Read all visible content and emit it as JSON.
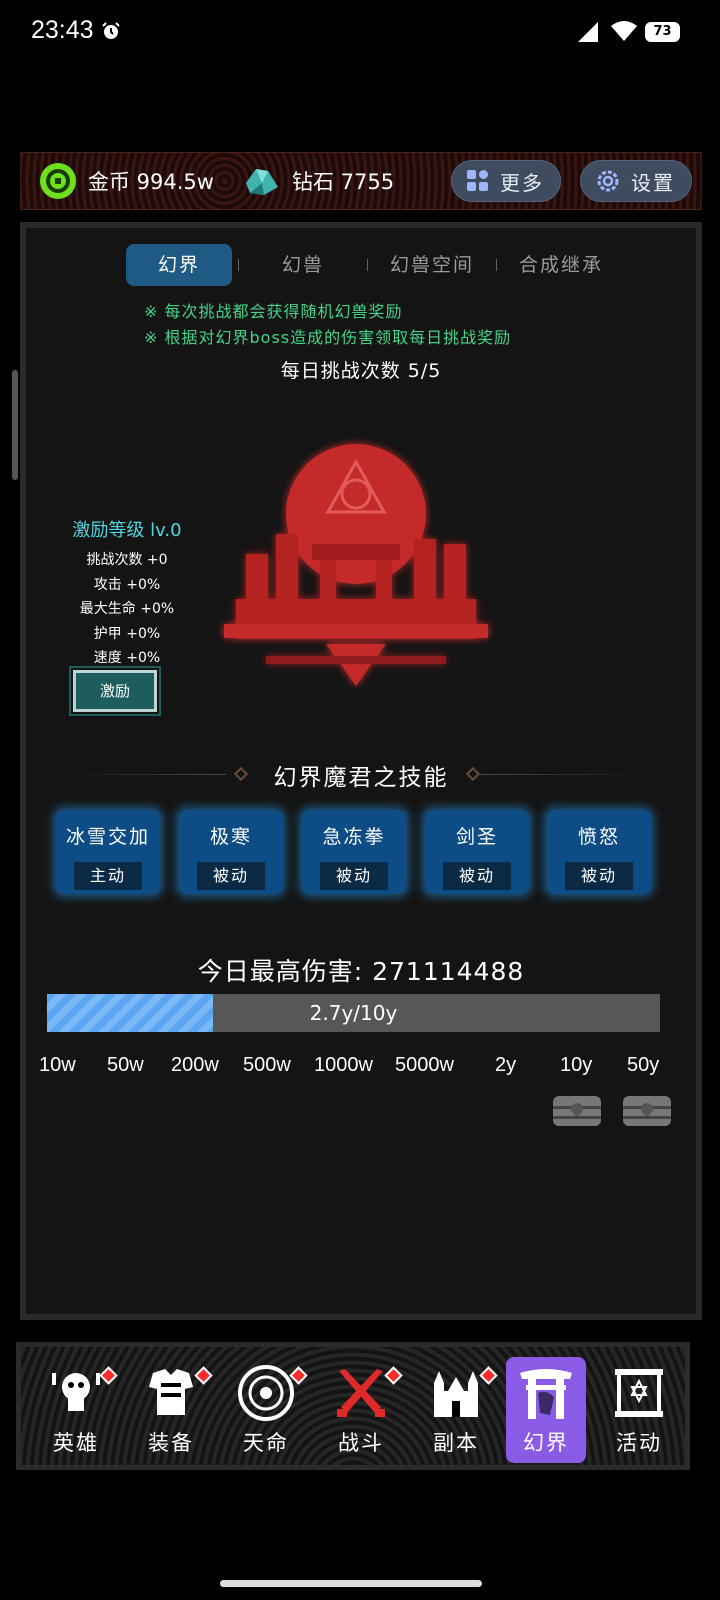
{
  "status": {
    "time": "23:43",
    "battery": "73"
  },
  "resources": {
    "coin_label": "金币 994.5w",
    "gem_label": "钻石 7755",
    "more_label": "更多",
    "settings_label": "设置"
  },
  "tabs": [
    {
      "label": "幻界",
      "active": true
    },
    {
      "label": "幻兽"
    },
    {
      "label": "幻兽空间"
    },
    {
      "label": "合成继承"
    }
  ],
  "tips": [
    "※ 每次挑战都会获得随机幻兽奖励",
    "※ 根据对幻界boss造成的伤害领取每日挑战奖励"
  ],
  "daily_challenges": "每日挑战次数 5/5",
  "buff": {
    "title": "激励等级 lv.0",
    "rows": [
      "挑战次数 +0",
      "攻击 +0%",
      "最大生命 +0%",
      "护甲 +0%",
      "速度 +0%"
    ],
    "button": "激励"
  },
  "skills_title": "幻界魔君之技能",
  "skills": [
    {
      "name": "冰雪交加",
      "type": "主动"
    },
    {
      "name": "极寒",
      "type": "被动"
    },
    {
      "name": "急冻拳",
      "type": "被动"
    },
    {
      "name": "剑圣",
      "type": "被动"
    },
    {
      "name": "愤怒",
      "type": "被动"
    }
  ],
  "damage": {
    "title": "今日最高伤害: 271114488",
    "progress_text": "2.7y/10y",
    "progress_fraction": 0.27,
    "milestones": [
      "10w",
      "50w",
      "200w",
      "500w",
      "1000w",
      "5000w",
      "2y",
      "10y",
      "50y"
    ]
  },
  "nav": [
    {
      "label": "英雄",
      "icon": "hero-icon",
      "badge": true
    },
    {
      "label": "装备",
      "icon": "armor-icon",
      "badge": true
    },
    {
      "label": "天命",
      "icon": "fate-icon",
      "badge": true
    },
    {
      "label": "战斗",
      "icon": "crossed-swords-icon",
      "badge": true
    },
    {
      "label": "副本",
      "icon": "castle-icon",
      "badge": true
    },
    {
      "label": "幻界",
      "icon": "gate-icon",
      "active": true
    },
    {
      "label": "活动",
      "icon": "scroll-icon"
    }
  ],
  "colors": {
    "accent_blue": "#1e5a84",
    "tip_green": "#44d488",
    "nav_active": "#8a5ce6",
    "badge_red": "#ff2a2a"
  }
}
